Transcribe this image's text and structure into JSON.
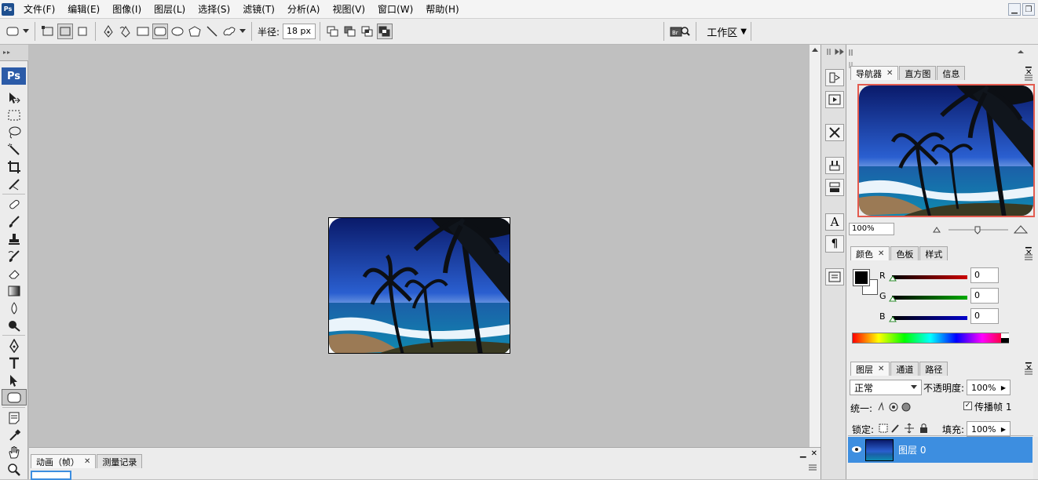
{
  "app": {
    "badge": "Ps",
    "menu": [
      "文件(F)",
      "编辑(E)",
      "图像(I)",
      "图层(L)",
      "选择(S)",
      "滤镜(T)",
      "分析(A)",
      "视图(V)",
      "窗口(W)",
      "帮助(H)"
    ]
  },
  "options_bar": {
    "radius_label": "半径:",
    "radius_value": "18 px",
    "bridge_label": "Br",
    "workspace_label": "工作区",
    "workspace_arrow": "▼"
  },
  "toolbox": {
    "logo": "Ps"
  },
  "navigator": {
    "tabs": [
      "导航器",
      "直方图",
      "信息"
    ],
    "zoom": "100%"
  },
  "color": {
    "tabs": [
      "颜色",
      "色板",
      "样式"
    ],
    "channels": [
      {
        "label": "R",
        "value": "0",
        "color": "#cc0000"
      },
      {
        "label": "G",
        "value": "0",
        "color": "#00aa00"
      },
      {
        "label": "B",
        "value": "0",
        "color": "#0000cc"
      }
    ]
  },
  "layers": {
    "tabs": [
      "图层",
      "通道",
      "路径"
    ],
    "blend_mode": "正常",
    "opacity_label": "不透明度:",
    "opacity_value": "100%",
    "unify_label": "统一:",
    "propagate_label": "传播帧 1",
    "lock_label": "锁定:",
    "fill_label": "填充:",
    "fill_value": "100%",
    "layer_name": "图层 0"
  },
  "bottom_panel": {
    "tabs": [
      "动画（帧）",
      "测量记录"
    ]
  },
  "colors": {
    "accent": "#3d8ee0",
    "nav_frame": "#e35b4f",
    "ps_blue": "#2b5ba8"
  }
}
